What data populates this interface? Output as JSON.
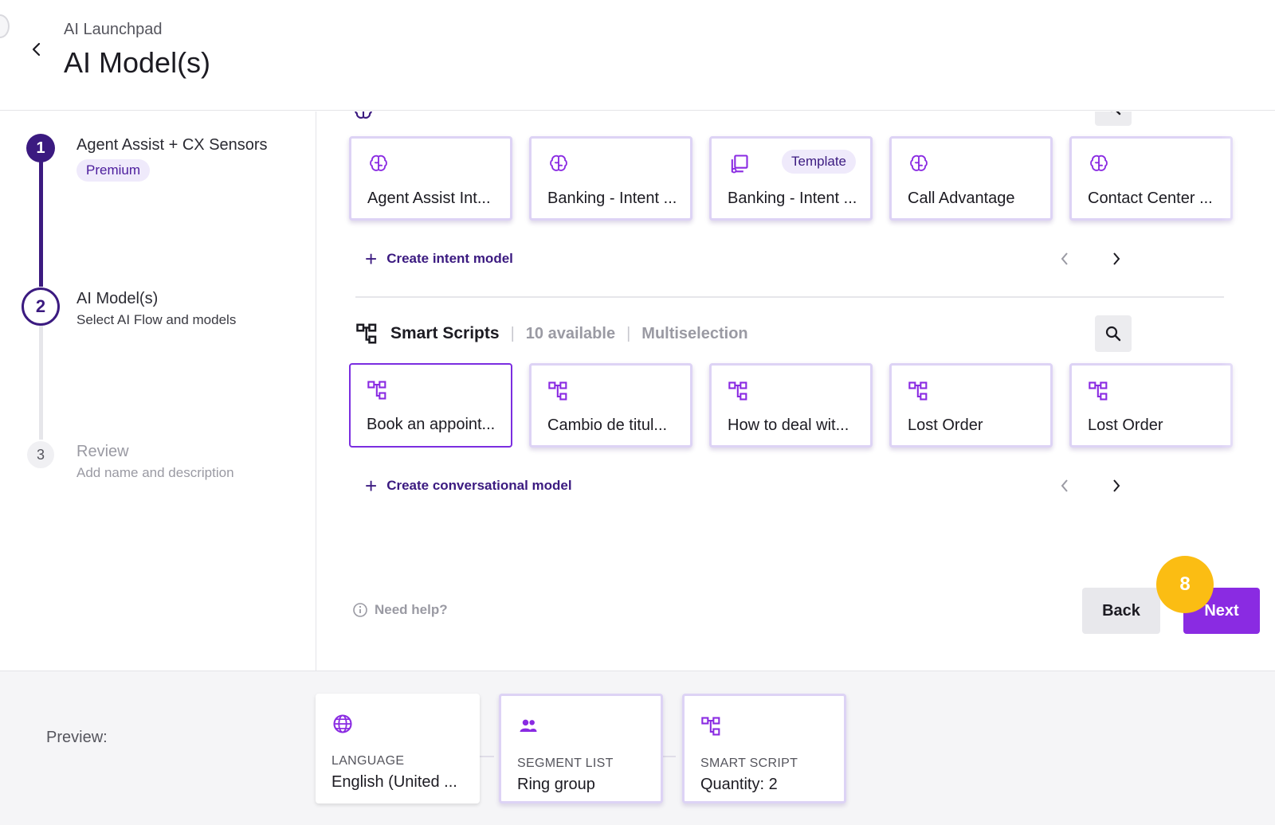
{
  "header": {
    "breadcrumb": "AI Launchpad",
    "title": "AI Model(s)"
  },
  "steps": [
    {
      "number": "1",
      "title": "Agent Assist + CX Sensors",
      "badge": "Premium",
      "state": "completed"
    },
    {
      "number": "2",
      "title": "AI Model(s)",
      "subtitle": "Select AI Flow and models",
      "state": "active"
    },
    {
      "number": "3",
      "title": "Review",
      "subtitle": "Add name and description",
      "state": "inactive"
    }
  ],
  "intent_section": {
    "icon": "brain-icon",
    "cards": [
      {
        "label": "Agent Assist Int...",
        "icon": "brain-icon"
      },
      {
        "label": "Banking - Intent ...",
        "icon": "brain-icon"
      },
      {
        "label": "Banking - Intent ...",
        "icon": "template-icon",
        "badge": "Template"
      },
      {
        "label": "Call Advantage",
        "icon": "brain-icon"
      },
      {
        "label": "Contact Center ...",
        "icon": "brain-icon"
      }
    ],
    "create_label": "Create intent model"
  },
  "scripts_section": {
    "icon": "flow-icon",
    "title": "Smart Scripts",
    "available": "10 available",
    "mode": "Multiselection",
    "cards": [
      {
        "label": "Book an appoint...",
        "icon": "flow-icon",
        "selected": true
      },
      {
        "label": "Cambio de titul...",
        "icon": "flow-icon",
        "selected": false
      },
      {
        "label": "How to deal wit...",
        "icon": "flow-icon",
        "selected": false
      },
      {
        "label": "Lost Order",
        "icon": "flow-icon",
        "selected": false
      },
      {
        "label": "Lost Order",
        "icon": "flow-icon",
        "selected": false
      }
    ],
    "create_label": "Create conversational model"
  },
  "footer": {
    "help": "Need help?",
    "back": "Back",
    "next": "Next",
    "step_marker": "8"
  },
  "preview": {
    "label": "Preview:",
    "cards": [
      {
        "caption": "LANGUAGE",
        "value": "English (United ...",
        "icon": "globe-icon"
      },
      {
        "caption": "SEGMENT LIST",
        "value": "Ring group",
        "icon": "people-icon"
      },
      {
        "caption": "SMART SCRIPT",
        "value": "Quantity: 2",
        "icon": "flow-icon"
      }
    ]
  },
  "colors": {
    "accent": "#8a2be2",
    "dark_purple": "#3b1a80",
    "step_marker": "#fbbd13"
  }
}
